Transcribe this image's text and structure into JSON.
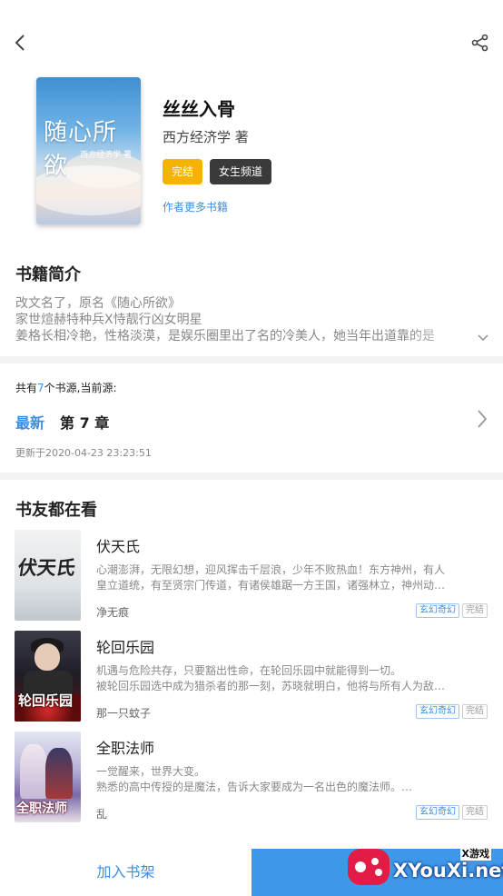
{
  "book": {
    "cover_title": "随心所欲",
    "cover_author": "西方经济学 著",
    "title": "丝丝入骨",
    "author": "西方经济学 著",
    "status_tag": "完结",
    "channel_tag": "女生频道",
    "more_books_link": "作者更多书籍"
  },
  "intro": {
    "heading": "书籍简介",
    "lines": [
      "改文名了，原名《随心所欲》",
      "家世煊赫特种兵X恃靓行凶女明星",
      "姜格长相冷艳，性格淡漠，是娱乐圈里出了名的冷美人，她当年出道靠的是"
    ]
  },
  "source": {
    "prefix": "共有",
    "count": "7",
    "suffix": "个书源,当前源:",
    "latest_label": "最新",
    "latest_chapter": "第 7 章",
    "updated": "更新于2020-04-23 23:23:51"
  },
  "recommend": {
    "heading": "书友都在看",
    "items": [
      {
        "name": "伏天氏",
        "cover_text": "伏天氏",
        "desc": [
          "心潮澎湃，无限幻想，迎风挥击千层浪，少年不败热血！东方神州，有人",
          "皇立道统，有至贤宗门传道，有诸侯雄踞一方王国，诸强林立，神州动…"
        ],
        "writer": "净无痕",
        "genre": "玄幻奇幻",
        "status": "完结"
      },
      {
        "name": "轮回乐园",
        "cover_text": "轮回乐园",
        "desc": [
          "机遇与危险共存，只要豁出性命，在轮回乐园中就能得到一切。",
          "被轮回乐园选中成为猎杀者的那一刻，苏晓就明白，他将与所有人为敌…"
        ],
        "writer": "那一只蚊子",
        "genre": "玄幻奇幻",
        "status": "完结"
      },
      {
        "name": "全职法师",
        "cover_text": "全职法师",
        "desc": [
          "一觉醒来，世界大变。",
          "熟悉的高中传授的是魔法，告诉大家要成为一名出色的魔法师。…"
        ],
        "writer": "乱",
        "genre": "玄幻奇幻",
        "status": "完结"
      }
    ]
  },
  "bottom": {
    "add_shelf": "加入书架"
  },
  "watermark": {
    "brand": "XYouXi.net",
    "cn": "X游戏"
  },
  "colors": {
    "accent": "#3b8ee0",
    "status_tag": "#f5b300",
    "channel_tag": "#3a3a3a",
    "read_button": "#3f97ea"
  }
}
